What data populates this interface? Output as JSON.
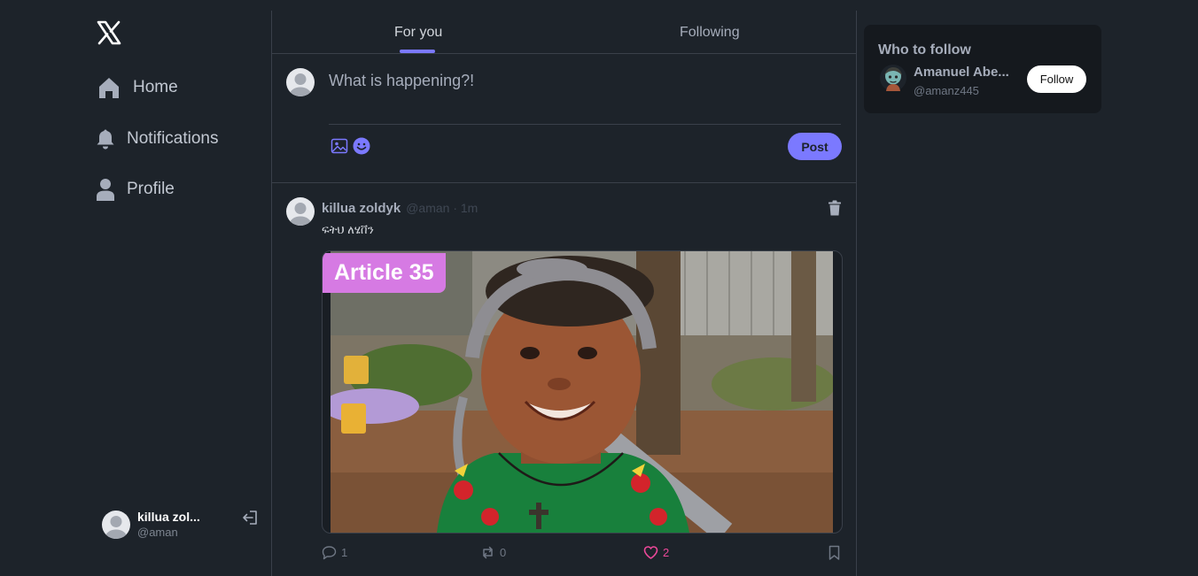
{
  "colors": {
    "background": "#1d232a",
    "accent": "#7b79ff",
    "like": "#ec4899",
    "panel": "#15191e",
    "border": "#3a404a",
    "article_tag": "#d67ae3"
  },
  "sidebar": {
    "logo_icon": "x-logo-icon",
    "items": [
      {
        "label": "Home",
        "icon": "home-icon"
      },
      {
        "label": "Notifications",
        "icon": "bell-icon"
      },
      {
        "label": "Profile",
        "icon": "user-icon"
      }
    ],
    "account": {
      "name": "killua zol...",
      "handle": "@aman",
      "logout_icon": "logout-icon"
    }
  },
  "main": {
    "tabs": [
      {
        "label": "For you",
        "active": true
      },
      {
        "label": "Following",
        "active": false
      }
    ],
    "composer": {
      "placeholder": "What is happening?!",
      "value": "",
      "post_label": "Post",
      "icons": [
        "image-icon",
        "emoji-icon"
      ]
    },
    "posts": [
      {
        "author": "killua zoldyk",
        "meta": "@aman · 1m",
        "text": "ፍትህ ለሄቨን",
        "media": {
          "overlay_text": "Article 35",
          "subject": "smiling child wearing a headband in a yard"
        },
        "actions": {
          "replies": "1",
          "reposts": "0",
          "likes": "2",
          "liked": true
        }
      }
    ]
  },
  "right": {
    "title": "Who to follow",
    "suggestions": [
      {
        "name": "Amanuel Abe...",
        "handle": "@amanz445",
        "button": "Follow"
      }
    ]
  }
}
